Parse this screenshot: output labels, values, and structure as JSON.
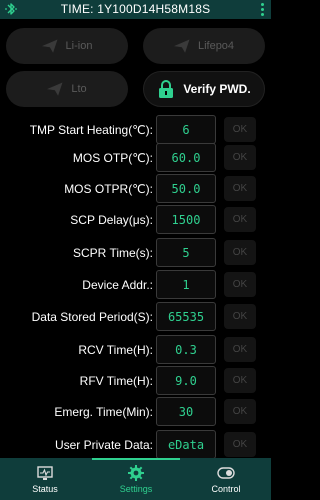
{
  "header": {
    "title": "TIME: 1Y100D14H58M18S"
  },
  "chem_buttons": [
    {
      "label": "Li-ion"
    },
    {
      "label": "Lifepo4"
    },
    {
      "label": "Lto"
    }
  ],
  "verify_button": {
    "label": "Verify PWD."
  },
  "settings": [
    {
      "label": "TMP Start Heating(℃):",
      "value": "6",
      "ok": "OK"
    },
    {
      "label": "MOS OTP(℃):",
      "value": "60.0",
      "ok": "OK"
    },
    {
      "label": "MOS OTPR(℃):",
      "value": "50.0",
      "ok": "OK"
    },
    {
      "label": "SCP Delay(μs):",
      "value": "1500",
      "ok": "OK"
    },
    {
      "label": "SCPR Time(s):",
      "value": "5",
      "ok": "OK"
    },
    {
      "label": "Device Addr.:",
      "value": "1",
      "ok": "OK"
    },
    {
      "label": "Data Stored Period(S):",
      "value": "65535",
      "ok": "OK"
    },
    {
      "label": "RCV Time(H):",
      "value": "0.3",
      "ok": "OK"
    },
    {
      "label": "RFV Time(H):",
      "value": "9.0",
      "ok": "OK"
    },
    {
      "label": "Emerg. Time(Min):",
      "value": "30",
      "ok": "OK"
    },
    {
      "label": "User Private Data:",
      "value": "eData",
      "ok": "OK"
    }
  ],
  "bottom_nav": [
    {
      "label": "Status",
      "icon": "monitor-icon"
    },
    {
      "label": "Settings",
      "icon": "gear-icon"
    },
    {
      "label": "Control",
      "icon": "toggle-icon"
    }
  ],
  "colors": {
    "accent": "#2fd08f",
    "bar": "#0f3d3b"
  }
}
